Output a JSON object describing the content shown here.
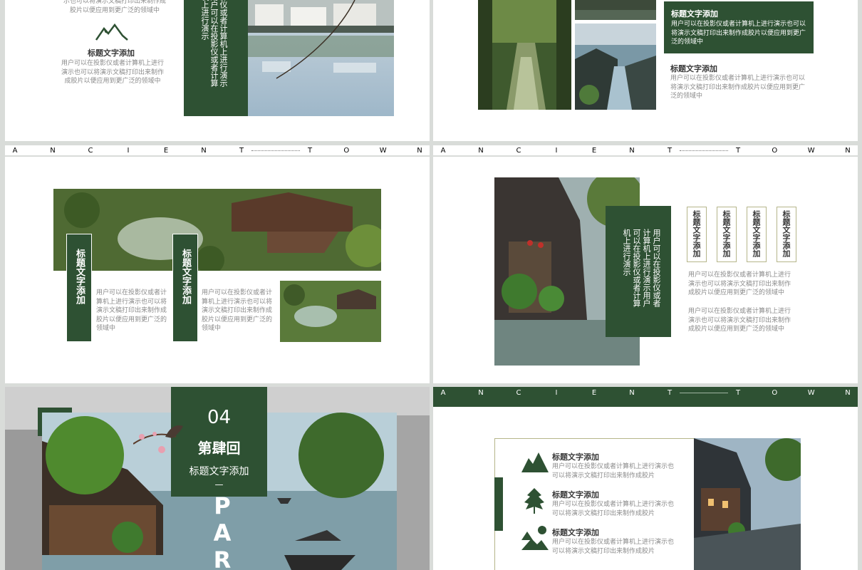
{
  "colors": {
    "accent": "#2e5133",
    "text": "#3a3a3a",
    "muted": "#8a8a8a"
  },
  "common": {
    "title": "标题文字添加",
    "body": "用户可以在投影仪或者计算机上进行演示也可以将演示文稿打印出来制作成胶片以便应用到更广泛的领域中",
    "body_short": "用户可以在投影仪或者计算机上进行演示也可以将演示文稿打印出来制作成胶片",
    "ancient_letters": [
      "A",
      "N",
      "C",
      "I",
      "E",
      "N",
      "T"
    ],
    "town_letters": [
      "T",
      "O",
      "W",
      "N"
    ]
  },
  "slide1": {
    "top_text": "示也可以将演示文稿打印出来制作成胶片以便应用到更广泛的领域中",
    "title": "标题文字添加",
    "body": "用户可以在投影仪或者计算机上进行演示也可以将演示文稿打印出来制作成胶片以便应用到更广泛的领域中",
    "vertical": "影仪或者计算机上进行演示用户可以在投影仪或者计算机上进行演示",
    "icon": "mountain-icon"
  },
  "slide2": {
    "card_title": "标题文字添加",
    "card_body": "用户可以在投影仪或者计算机上进行演示也可以将演示文稿打印出来制作成胶片以便应用到更广泛的领域中",
    "title": "标题文字添加",
    "body": "用户可以在投影仪或者计算机上进行演示也可以将演示文稿打印出来制作成胶片以便应用到更广泛的领域中"
  },
  "slide3": {
    "tag1": "标题文字添加",
    "tag2": "标题文字添加",
    "body1": "用户可以在投影仪或者计算机上进行演示也可以将演示文稿打印出来制作成胶片以便应用到更广泛的领域中",
    "body2": "用户可以在投影仪或者计算机上进行演示也可以将演示文稿打印出来制作成胶片以便应用到更广泛的领域中"
  },
  "slide4": {
    "vertical": "用户可以在投影仪或者计算机上进行演示用户可以在投影仪或者计算机上进行演示",
    "tags": [
      "标题文字添加",
      "标题文字添加",
      "标题文字添加",
      "标题文字添加"
    ],
    "body1": "用户可以在投影仪或者计算机上进行演示也可以将演示文稿打印出来制作成胶片以便应用到更广泛的领域中",
    "body2": "用户可以在投影仪或者计算机上进行演示也可以将演示文稿打印出来制作成胶片以便应用到更广泛的领域中"
  },
  "slide5": {
    "number": "04",
    "chapter": "第肆回",
    "subtitle": "标题文字添加",
    "dash": "—",
    "part": "PAR"
  },
  "slide6": {
    "items": [
      {
        "title": "标题文字添加",
        "body": "用户可以在投影仪或者计算机上进行演示也可以将演示文稿打印出来制作成胶片",
        "icon": "mountain-icon"
      },
      {
        "title": "标题文字添加",
        "body": "用户可以在投影仪或者计算机上进行演示也可以将演示文稿打印出来制作成胶片",
        "icon": "leaf-icon"
      },
      {
        "title": "标题文字添加",
        "body": "用户可以在投影仪或者计算机上进行演示也可以将演示文稿打印出来制作成胶片",
        "icon": "landscape-icon"
      }
    ]
  }
}
